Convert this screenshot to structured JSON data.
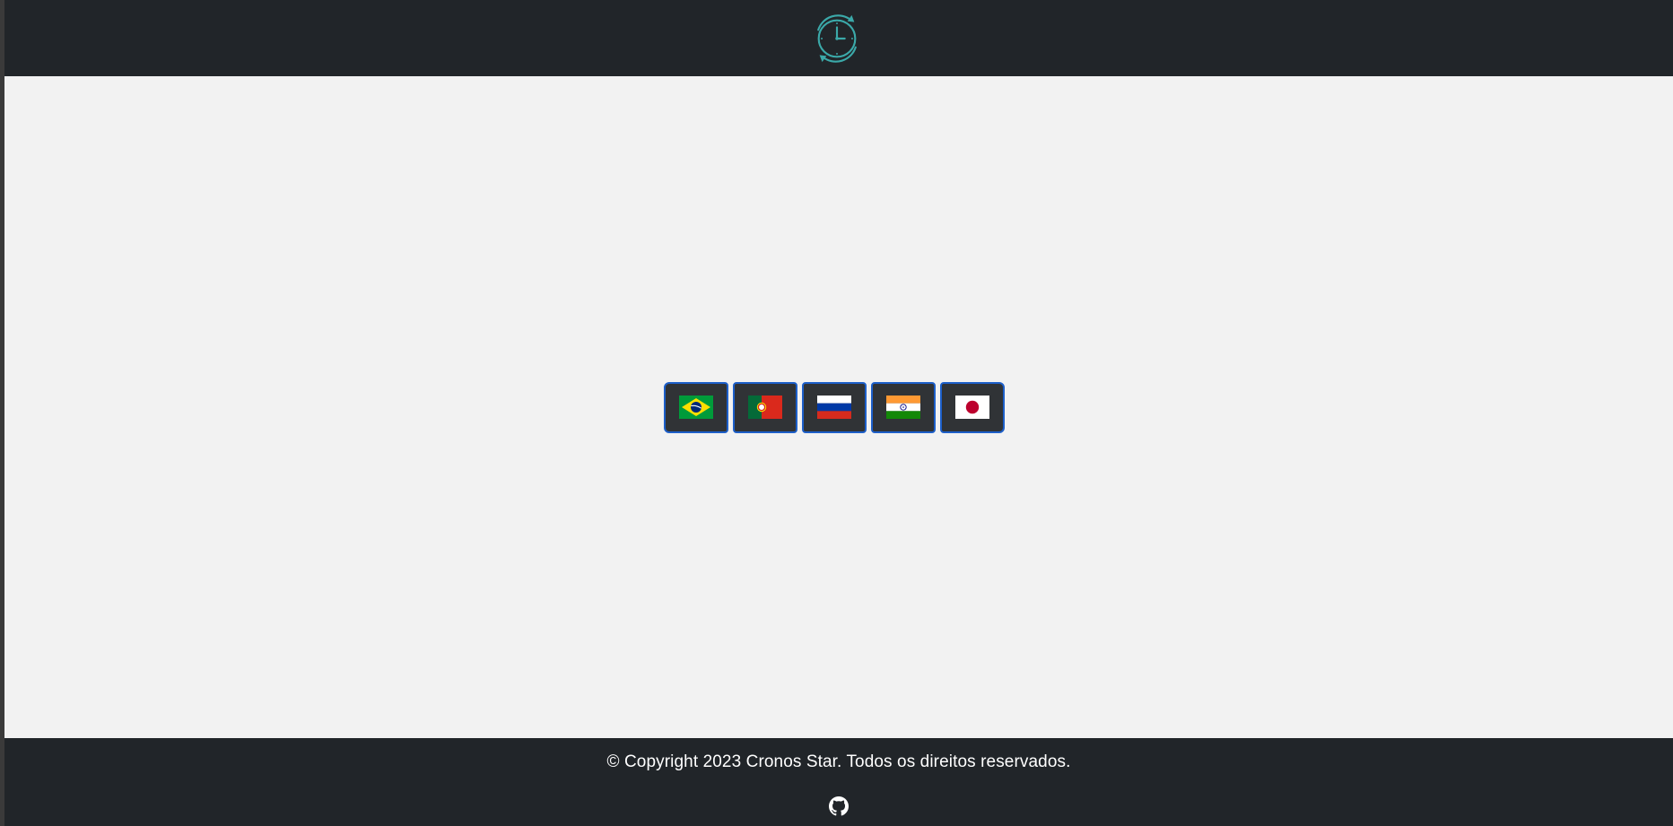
{
  "header": {
    "logo_icon": "clock-refresh-icon",
    "accent": "#3ba9a9"
  },
  "language_selector": {
    "flags": [
      {
        "icon": "brazil-flag-icon",
        "country": "Brazil"
      },
      {
        "icon": "portugal-flag-icon",
        "country": "Portugal"
      },
      {
        "icon": "russia-flag-icon",
        "country": "Russia"
      },
      {
        "icon": "india-flag-icon",
        "country": "India"
      },
      {
        "icon": "japan-flag-icon",
        "country": "Japan"
      }
    ],
    "button_border": "#1d5fc9"
  },
  "footer": {
    "copyright": "© Copyright 2023 Cronos Star. Todos os direitos reservados.",
    "github_icon": "github-icon"
  },
  "colors": {
    "header_bg": "#212529",
    "main_bg": "#f2f2f2",
    "footer_bg": "#212529"
  }
}
